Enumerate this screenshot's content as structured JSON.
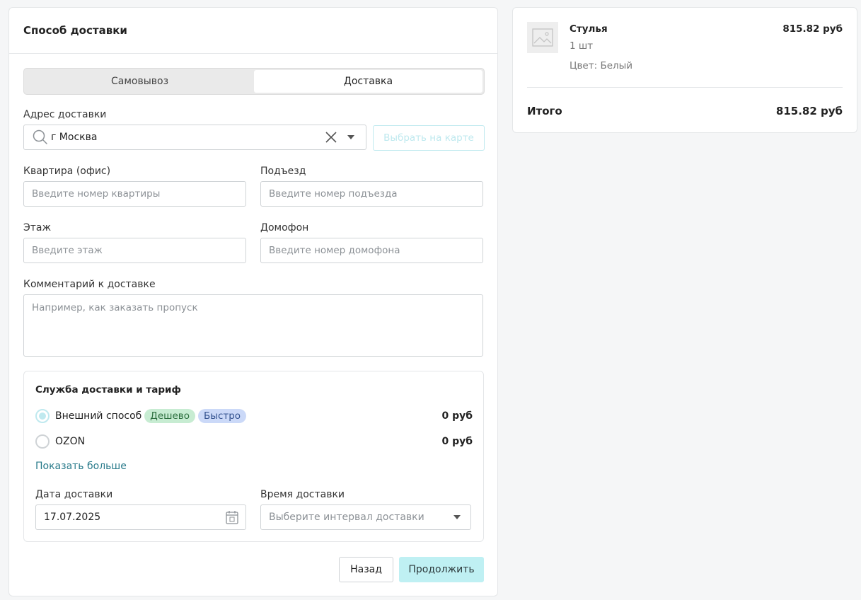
{
  "delivery": {
    "title": "Способ доставки",
    "tabs": [
      {
        "label": "Самовывоз",
        "active": false
      },
      {
        "label": "Доставка",
        "active": true
      }
    ],
    "address": {
      "label": "Адрес доставки",
      "value": "г Москва",
      "map_button": "Выбрать на карте"
    },
    "fields": {
      "apartment": {
        "label": "Квартира (офис)",
        "placeholder": "Введите номер квартиры"
      },
      "entrance": {
        "label": "Подъезд",
        "placeholder": "Введите номер подъезда"
      },
      "floor": {
        "label": "Этаж",
        "placeholder": "Введите этаж"
      },
      "intercom": {
        "label": "Домофон",
        "placeholder": "Введите номер домофона"
      },
      "comment": {
        "label": "Комментарий к доставке",
        "placeholder": "Например, как заказать пропуск"
      }
    },
    "service": {
      "title": "Служба доставки и тариф",
      "options": [
        {
          "name": "Внешний способ",
          "selected": true,
          "badges": [
            "Дешево",
            "Быстро"
          ],
          "price": "0 руб"
        },
        {
          "name": "OZON",
          "selected": false,
          "badges": [],
          "price": "0 руб"
        }
      ],
      "show_more": "Показать больше",
      "date_label": "Дата доставки",
      "date_value": "17.07.2025",
      "time_label": "Время доставки",
      "time_placeholder": "Выберите интервал доставки"
    },
    "buttons": {
      "back": "Назад",
      "next": "Продолжить"
    }
  },
  "order": {
    "item": {
      "name": "Стулья",
      "qty": "1 шт",
      "color": "Цвет: Белый",
      "price": "815.82 руб"
    },
    "total_label": "Итого",
    "total_value": "815.82 руб"
  },
  "colors": {
    "accent": "#bff0f3",
    "badge_green": "#c7ecd2",
    "badge_blue": "#cbd9f8",
    "link": "#2a7b8b"
  }
}
